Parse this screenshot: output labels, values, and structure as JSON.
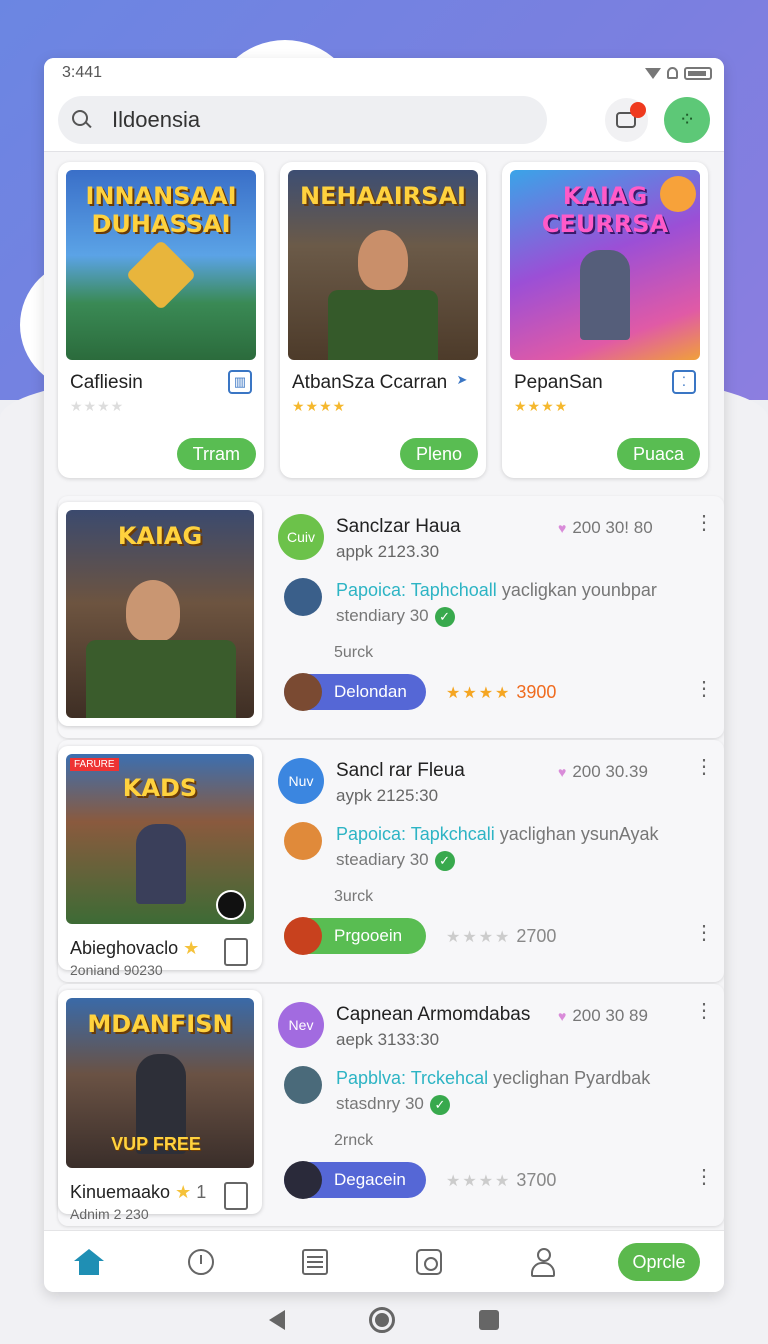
{
  "status": {
    "time": "3:441"
  },
  "search": {
    "value": "Ildoensia"
  },
  "top_cards": [
    {
      "art": "INNANSAAI DUHASSAI",
      "name": "Cafliesin",
      "stars": "★★★★",
      "button": "Trram",
      "icon": "grid-icon"
    },
    {
      "art": "NEHAAIRSAI",
      "name": "AtbanSza Ccarran",
      "stars": "★★★★",
      "button": "Pleno",
      "icon": "send-icon"
    },
    {
      "art": "KAIAG CEURRSA",
      "name": "PepanSan",
      "stars": "★★★★",
      "button": "Puaca",
      "icon": "dots-icon"
    }
  ],
  "rows": [
    {
      "art": "KAIAG",
      "avatar": "Cuiv",
      "title": "Sanclzar Haua",
      "sub": "appk 2123.30",
      "meta": "200 30! 80",
      "desc_hl": "Papoica: Taphchoall",
      "desc_rest": "yacligkan younbpar",
      "desc2": "stendiary 30",
      "small": "5urck",
      "pill": "Delondan",
      "rating_stars": "★★★★",
      "rating": "3900"
    },
    {
      "art": "KADS",
      "badge": "FARURE",
      "card_name": "Abieghovaclo",
      "card_sub": "2oniand 90230",
      "avatar": "Nuv",
      "title": "Sancl rar Fleua",
      "sub": "aypk 2125:30",
      "meta": "200 30.39",
      "desc_hl": "Papoica: Tapkchcali",
      "desc_rest": "yaclighan ysunAyak",
      "desc2": "steadiary 30",
      "small": "3urck",
      "pill": "Prgooein",
      "rating_stars": "★★★★",
      "rating": "2700"
    },
    {
      "art": "MDANFISN",
      "art_sub": "VUP FREE",
      "card_name": "Kinuemaako",
      "card_num": "1",
      "card_sub": "Adnim 2 230",
      "avatar": "Nev",
      "title": "Capnean Armomdabas",
      "sub": "aepk 3133:30",
      "meta": "200 30 89",
      "desc_hl": "Papblva: Trckehcal",
      "desc_rest": "yeclighan Pyardbak",
      "desc2": "stasdnry 30",
      "small": "2rnck",
      "pill": "Degacein",
      "rating_stars": "★★★★",
      "rating": "3700"
    }
  ],
  "bottom_nav": {
    "button": "Oprcle"
  },
  "colors": {
    "accent_green": "#59bd52",
    "accent_blue": "#5567d6",
    "bg_purple": "#6b86e2"
  }
}
